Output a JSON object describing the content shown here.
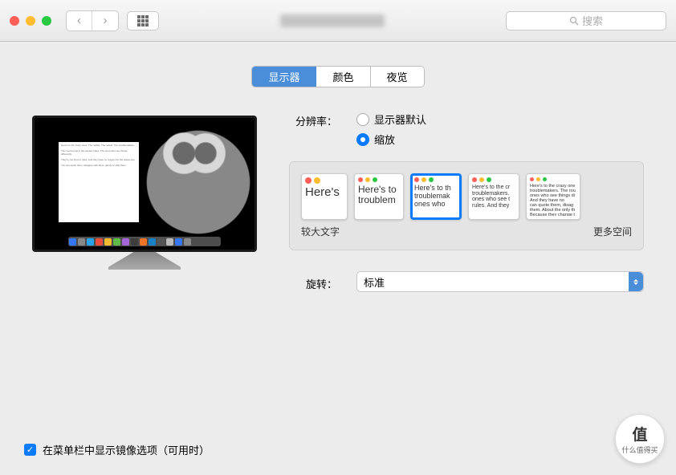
{
  "toolbar": {
    "search_placeholder": "搜索"
  },
  "tabs": {
    "display": "显示器",
    "color": "颜色",
    "night": "夜览"
  },
  "resolution": {
    "label": "分辨率：",
    "default": "显示器默认",
    "scaled": "缩放",
    "selected": "scaled"
  },
  "scale": {
    "larger_text": "较大文字",
    "more_space": "更多空间",
    "selected_index": 2,
    "thumbs": [
      {
        "text": "Here's"
      },
      {
        "text": "Here's to\ntroublem"
      },
      {
        "text": "Here's to th\ntroublemak\nones who"
      },
      {
        "text": "Here's to the cr\ntroublemakers.\nones who see t\nrules. And they"
      },
      {
        "text": "Here's to the crazy one\ntroublemakers. The rou\nones who see things di\nAnd they have no\ncan quote them, disag\nthem. About the only th\nBecause they change t"
      }
    ]
  },
  "rotation": {
    "label": "旋转：",
    "value": "标准"
  },
  "mirror": {
    "label": "在菜单栏中显示镜像选项（可用时）",
    "checked": true
  },
  "watermark": {
    "brand": "值",
    "tagline": "什么值得买"
  }
}
